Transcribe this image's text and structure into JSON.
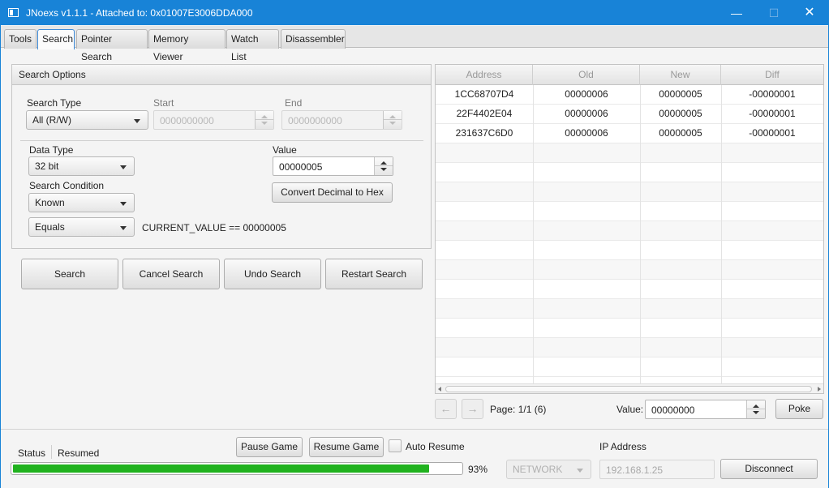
{
  "window": {
    "title": "JNoexs v1.1.1 - Attached to: 0x01007E3006DDA000"
  },
  "tabs": [
    {
      "label": "Tools"
    },
    {
      "label": "Search"
    },
    {
      "label": "Pointer Search"
    },
    {
      "label": "Memory Viewer"
    },
    {
      "label": "Watch List"
    },
    {
      "label": "Disassembler"
    }
  ],
  "search_options": {
    "header": "Search Options",
    "search_type_label": "Search Type",
    "search_type_value": "All (R/W)",
    "start_label": "Start",
    "start_value": "0000000000",
    "end_label": "End",
    "end_value": "0000000000",
    "data_type_label": "Data Type",
    "data_type_value": "32 bit",
    "value_label": "Value",
    "value_value": "00000005",
    "convert_button": "Convert Decimal to Hex",
    "search_condition_label": "Search Condition",
    "search_condition_value": "Known",
    "compare_value": "Equals",
    "condition_text": "CURRENT_VALUE == 00000005"
  },
  "actions": {
    "search": "Search",
    "cancel": "Cancel Search",
    "undo": "Undo Search",
    "restart": "Restart Search"
  },
  "results": {
    "columns": [
      "Address",
      "Old",
      "New",
      "Diff"
    ],
    "rows": [
      [
        "1CC68707D4",
        "00000006",
        "00000005",
        "-00000001"
      ],
      [
        "22F4402E04",
        "00000006",
        "00000005",
        "-00000001"
      ],
      [
        "231637C6D0",
        "00000006",
        "00000005",
        "-00000001"
      ]
    ]
  },
  "pager": {
    "prev_icon": "arrow-left-icon",
    "prev": "←",
    "next_icon": "arrow-right-icon",
    "next": "→",
    "page_text": "Page: 1/1 (6)",
    "value_label": "Value:",
    "value_value": "00000000",
    "poke_button": "Poke"
  },
  "status_bar": {
    "status_label": "Status",
    "status_value": "Resumed",
    "progress_percent": 93,
    "progress_text": "93%",
    "pause_button": "Pause Game",
    "resume_button": "Resume Game",
    "auto_resume_label": "Auto Resume",
    "auto_resume_checked": false,
    "connection_type": "NETWORK",
    "ip_label": "IP Address",
    "ip_value": "192.168.1.25",
    "disconnect_button": "Disconnect"
  },
  "colors": {
    "titlebar": "#1883d7",
    "progress": "#20b21e"
  }
}
